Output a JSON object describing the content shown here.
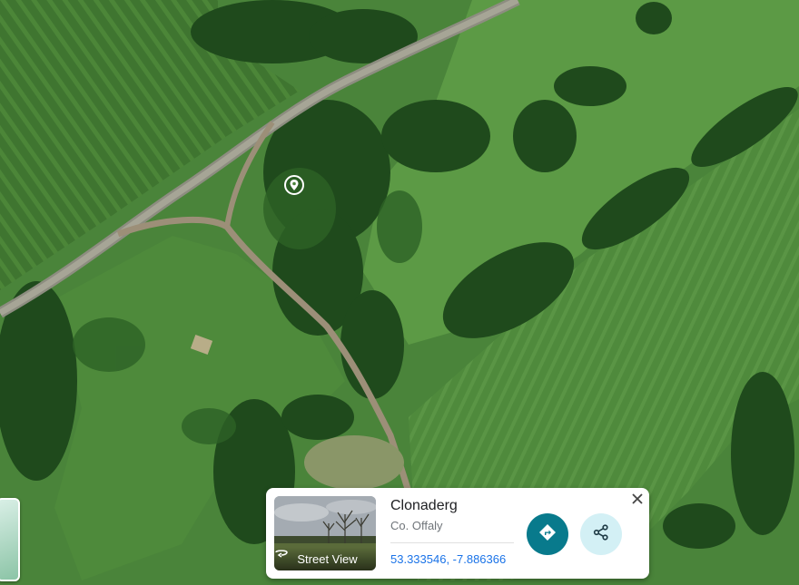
{
  "place": {
    "name": "Clonaderg",
    "region": "Co. Offaly",
    "coordinates": "53.333546, -7.886366"
  },
  "street_view": {
    "label": "Street View"
  },
  "icons": {
    "pin": "location-pin-icon",
    "directions": "directions-icon",
    "share": "share-icon",
    "close": "close-icon",
    "street_view": "street-view-icon"
  },
  "colors": {
    "directions_button": "#087a8c",
    "share_button": "#d3f0f5",
    "link": "#1a73e8"
  }
}
